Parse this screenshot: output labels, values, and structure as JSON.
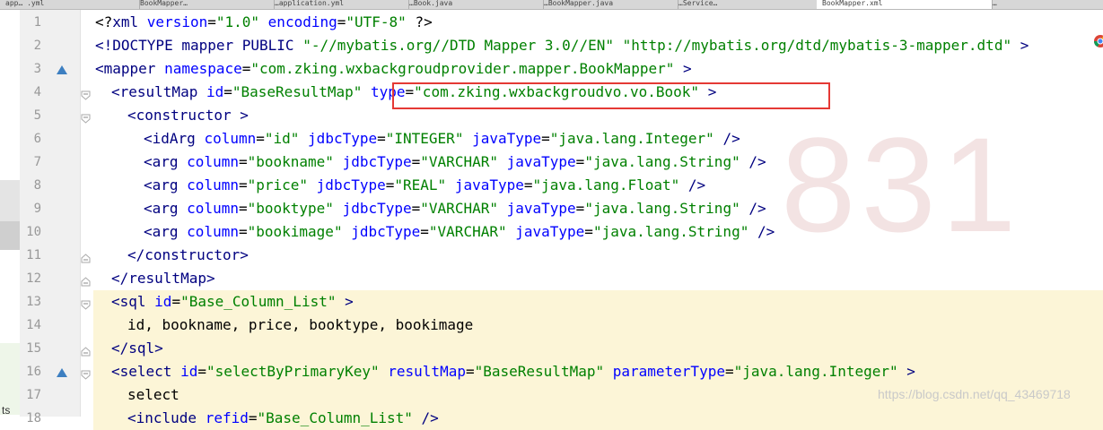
{
  "tabs": [
    {
      "label": "app… .yml"
    },
    {
      "label": "BookMapper…"
    },
    {
      "label": "…application.yml"
    },
    {
      "label": "…Book.java"
    },
    {
      "label": "…BookMapper.java"
    },
    {
      "label": "…Service…"
    },
    {
      "label": "BookMapper.xml"
    },
    {
      "label": "…"
    }
  ],
  "lines": [
    {
      "no": "1",
      "indent": 0,
      "tokens": [
        [
          "sym",
          "<?"
        ],
        [
          "tag",
          "xml "
        ],
        [
          "attr",
          "version"
        ],
        [
          "sym",
          "="
        ],
        [
          "val",
          "\"1.0\" "
        ],
        [
          "attr",
          "encoding"
        ],
        [
          "sym",
          "="
        ],
        [
          "val",
          "\"UTF-8\" "
        ],
        [
          "sym",
          "?>"
        ]
      ]
    },
    {
      "no": "2",
      "indent": 0,
      "tokens": [
        [
          "tag",
          "<!DOCTYPE mapper PUBLIC "
        ],
        [
          "val",
          "\"-//mybatis.org//DTD Mapper 3.0//EN\" \"http://mybatis.org/dtd/mybatis-3-mapper.dtd\" "
        ],
        [
          "tag",
          ">"
        ]
      ]
    },
    {
      "no": "3",
      "indent": 0,
      "tokens": [
        [
          "tag",
          "<mapper "
        ],
        [
          "attr",
          "namespace"
        ],
        [
          "sym",
          "="
        ],
        [
          "val",
          "\"com.zking.wxbackgroudprovider.mapper.BookMapper\" "
        ],
        [
          "tag",
          ">"
        ]
      ]
    },
    {
      "no": "4",
      "indent": 1,
      "tokens": [
        [
          "tag",
          "<resultMap "
        ],
        [
          "attr",
          "id"
        ],
        [
          "sym",
          "="
        ],
        [
          "val",
          "\"BaseResultMap\" "
        ],
        [
          "attr",
          "type"
        ],
        [
          "sym",
          "="
        ],
        [
          "val",
          "\"com.zking.wxbackgroudvo.vo.Book\" "
        ],
        [
          "tag",
          ">"
        ]
      ]
    },
    {
      "no": "5",
      "indent": 2,
      "tokens": [
        [
          "tag",
          "<constructor "
        ],
        [
          "tag",
          ">"
        ]
      ]
    },
    {
      "no": "6",
      "indent": 3,
      "tokens": [
        [
          "tag",
          "<idArg "
        ],
        [
          "attr",
          "column"
        ],
        [
          "sym",
          "="
        ],
        [
          "val",
          "\"id\" "
        ],
        [
          "attr",
          "jdbcType"
        ],
        [
          "sym",
          "="
        ],
        [
          "val",
          "\"INTEGER\" "
        ],
        [
          "attr",
          "javaType"
        ],
        [
          "sym",
          "="
        ],
        [
          "val",
          "\"java.lang.Integer\" "
        ],
        [
          "tag",
          "/>"
        ]
      ]
    },
    {
      "no": "7",
      "indent": 3,
      "tokens": [
        [
          "tag",
          "<arg "
        ],
        [
          "attr",
          "column"
        ],
        [
          "sym",
          "="
        ],
        [
          "val",
          "\"bookname\" "
        ],
        [
          "attr",
          "jdbcType"
        ],
        [
          "sym",
          "="
        ],
        [
          "val",
          "\"VARCHAR\" "
        ],
        [
          "attr",
          "javaType"
        ],
        [
          "sym",
          "="
        ],
        [
          "val",
          "\"java.lang.String\" "
        ],
        [
          "tag",
          "/>"
        ]
      ]
    },
    {
      "no": "8",
      "indent": 3,
      "tokens": [
        [
          "tag",
          "<arg "
        ],
        [
          "attr",
          "column"
        ],
        [
          "sym",
          "="
        ],
        [
          "val",
          "\"price\" "
        ],
        [
          "attr",
          "jdbcType"
        ],
        [
          "sym",
          "="
        ],
        [
          "val",
          "\"REAL\" "
        ],
        [
          "attr",
          "javaType"
        ],
        [
          "sym",
          "="
        ],
        [
          "val",
          "\"java.lang.Float\" "
        ],
        [
          "tag",
          "/>"
        ]
      ]
    },
    {
      "no": "9",
      "indent": 3,
      "tokens": [
        [
          "tag",
          "<arg "
        ],
        [
          "attr",
          "column"
        ],
        [
          "sym",
          "="
        ],
        [
          "val",
          "\"booktype\" "
        ],
        [
          "attr",
          "jdbcType"
        ],
        [
          "sym",
          "="
        ],
        [
          "val",
          "\"VARCHAR\" "
        ],
        [
          "attr",
          "javaType"
        ],
        [
          "sym",
          "="
        ],
        [
          "val",
          "\"java.lang.String\" "
        ],
        [
          "tag",
          "/>"
        ]
      ]
    },
    {
      "no": "10",
      "indent": 3,
      "tokens": [
        [
          "tag",
          "<arg "
        ],
        [
          "attr",
          "column"
        ],
        [
          "sym",
          "="
        ],
        [
          "val",
          "\"bookimage\" "
        ],
        [
          "attr",
          "jdbcType"
        ],
        [
          "sym",
          "="
        ],
        [
          "val",
          "\"VARCHAR\" "
        ],
        [
          "attr",
          "javaType"
        ],
        [
          "sym",
          "="
        ],
        [
          "val",
          "\"java.lang.String\" "
        ],
        [
          "tag",
          "/>"
        ]
      ]
    },
    {
      "no": "11",
      "indent": 2,
      "tokens": [
        [
          "tag",
          "</constructor>"
        ]
      ]
    },
    {
      "no": "12",
      "indent": 1,
      "tokens": [
        [
          "tag",
          "</resultMap>"
        ]
      ]
    },
    {
      "no": "13",
      "indent": 1,
      "tokens": [
        [
          "tag",
          "<sql "
        ],
        [
          "attr",
          "id"
        ],
        [
          "sym",
          "="
        ],
        [
          "val",
          "\"Base_Column_List\" "
        ],
        [
          "tag",
          ">"
        ]
      ]
    },
    {
      "no": "14",
      "indent": 2,
      "tokens": [
        [
          "sym",
          "id, bookname, price, booktype, bookimage"
        ]
      ]
    },
    {
      "no": "15",
      "indent": 1,
      "tokens": [
        [
          "tag",
          "</sql>"
        ]
      ]
    },
    {
      "no": "16",
      "indent": 1,
      "tokens": [
        [
          "tag",
          "<select "
        ],
        [
          "attr",
          "id"
        ],
        [
          "sym",
          "="
        ],
        [
          "val",
          "\"selectByPrimaryKey\" "
        ],
        [
          "attr",
          "resultMap"
        ],
        [
          "sym",
          "="
        ],
        [
          "val",
          "\"BaseResultMap\" "
        ],
        [
          "attr",
          "parameterType"
        ],
        [
          "sym",
          "="
        ],
        [
          "val",
          "\"java.lang.Integer\" "
        ],
        [
          "tag",
          ">"
        ]
      ]
    },
    {
      "no": "17",
      "indent": 2,
      "tokens": [
        [
          "sym",
          "select"
        ]
      ]
    },
    {
      "no": "18",
      "indent": 2,
      "tokens": [
        [
          "tag",
          "<include "
        ],
        [
          "attr",
          "refid"
        ],
        [
          "sym",
          "="
        ],
        [
          "val",
          "\"Base_Column_List\" "
        ],
        [
          "tag",
          "/>"
        ]
      ]
    }
  ],
  "watermark": "https://blog.csdn.net/qq_43469718",
  "left_edge_text": "ts",
  "colors": {
    "tag": "#000080",
    "attr": "#0000ff",
    "value": "#008000",
    "highlight": "#fcf5d7",
    "annotation": "#e53935"
  }
}
